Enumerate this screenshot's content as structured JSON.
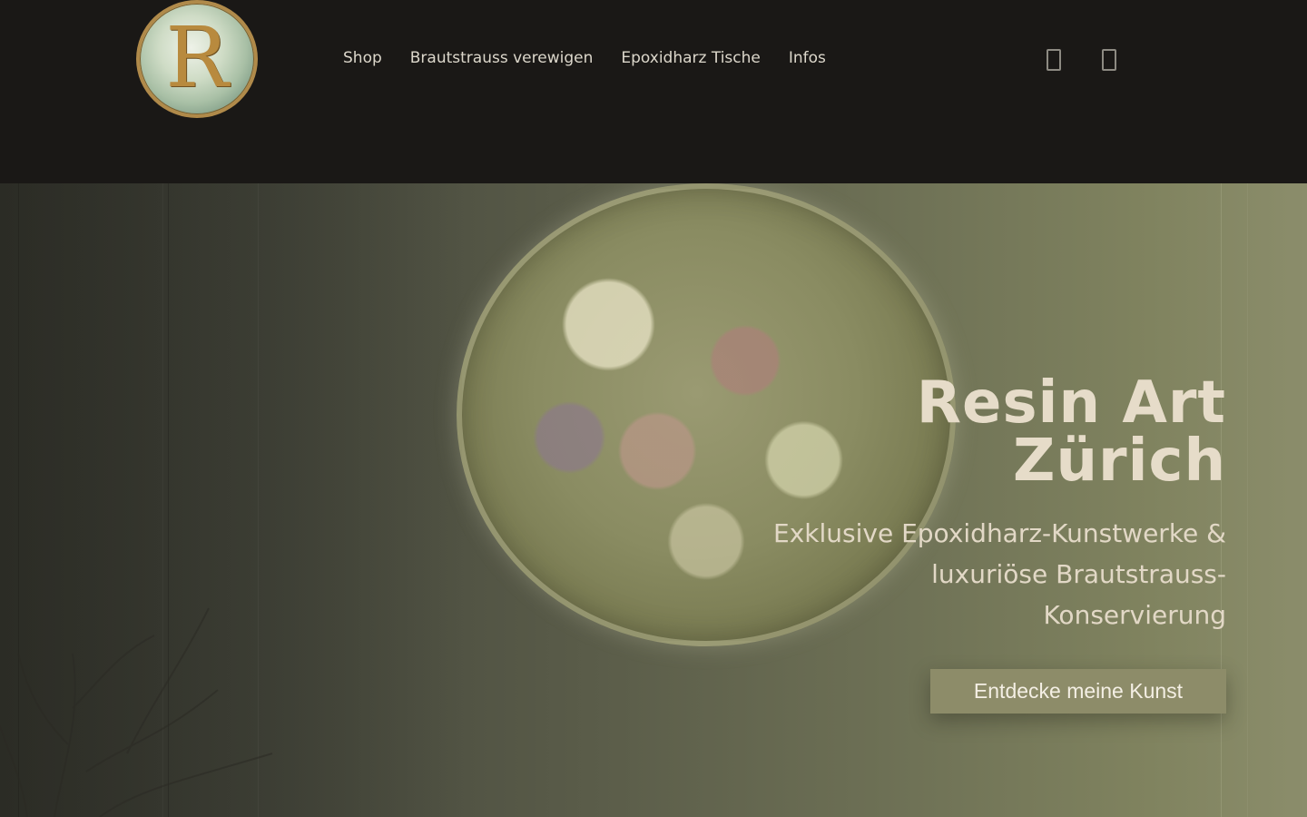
{
  "header": {
    "logo_letter": "R",
    "nav": [
      {
        "label": "Shop"
      },
      {
        "label": "Brautstrauss verewigen"
      },
      {
        "label": "Epoxidharz Tische"
      },
      {
        "label": "Infos"
      }
    ],
    "icons": [
      "search-icon",
      "cart-icon"
    ]
  },
  "hero": {
    "title": "Resin Art Zürich",
    "subtitle": "Exklusive Epoxidharz-Kunstwerke & luxuriöse Brautstrauss-Konservierung",
    "cta_label": "Entdecke meine Kunst"
  },
  "colors": {
    "header_bg": "#1a1816",
    "nav_text": "#dcd7cb",
    "hero_title": "#e6dcc9",
    "cta_bg": "#8d8c69",
    "logo_gold": "#b08a4a"
  }
}
